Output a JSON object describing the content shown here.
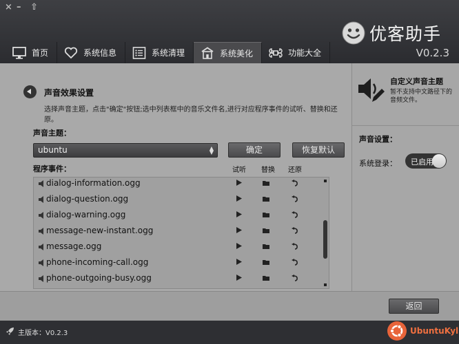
{
  "window": {
    "controls": [
      "×",
      "–",
      "⇧"
    ]
  },
  "brand": {
    "name": "优客助手",
    "version": "V0.2.3"
  },
  "tabs": [
    {
      "label": "首页",
      "icon": "monitor-icon"
    },
    {
      "label": "系统信息",
      "icon": "heart-icon"
    },
    {
      "label": "系统清理",
      "icon": "list-icon"
    },
    {
      "label": "系统美化",
      "icon": "home-icon",
      "active": true
    },
    {
      "label": "功能大全",
      "icon": "command-icon"
    }
  ],
  "section": {
    "title": "声音效果设置",
    "subtitle": "选择声音主题，点击\"确定\"按钮;选中列表框中的音乐文件名,进行对应程序事件的试听、替换和还原。"
  },
  "theme": {
    "label": "声音主题：",
    "selected": "ubuntu",
    "confirm": "确定",
    "restore": "恢复默认"
  },
  "events": {
    "label": "程序事件：",
    "columns": {
      "listen": "试听",
      "replace": "替换",
      "revert": "还原"
    },
    "items": [
      "dialog-information.ogg",
      "dialog-question.ogg",
      "dialog-warning.ogg",
      "message-new-instant.ogg",
      "message.ogg",
      "phone-incoming-call.ogg",
      "phone-outgoing-busy.ogg"
    ]
  },
  "sidebar": {
    "title": "自定义声音主题",
    "desc": "暂不支持中文路径下的音频文件。",
    "settings_label": "声音设置：",
    "login_label": "系统登录：",
    "toggle_text": "已启用",
    "toggle_on": true
  },
  "footer": {
    "back": "返回"
  },
  "bottom": {
    "version": "主版本：V0.2.3",
    "distro": "UbuntuKylin"
  },
  "colors": {
    "accent": "#f07040",
    "header": "#333437",
    "panel": "#a9a9a9"
  }
}
